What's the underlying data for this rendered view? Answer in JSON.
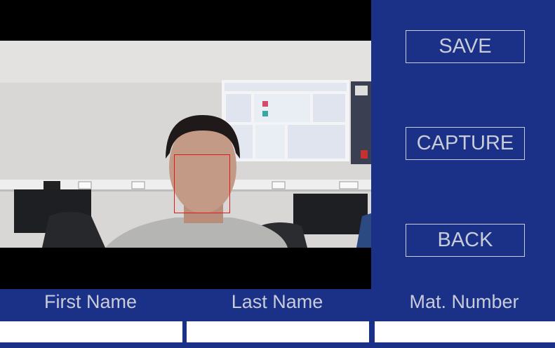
{
  "colors": {
    "background": "#1b3188",
    "button_text": "#c8cbd8",
    "button_border": "#c9cde0",
    "face_box": "#e01818",
    "input_background": "#ffffff"
  },
  "camera": {
    "icon": "webcam-feed",
    "face_detected": true
  },
  "buttons": {
    "save": "SAVE",
    "capture": "CAPTURE",
    "back": "BACK"
  },
  "form": {
    "first_name_label": "First Name",
    "last_name_label": "Last Name",
    "mat_number_label": "Mat. Number",
    "first_name_value": "",
    "last_name_value": "",
    "mat_number_value": ""
  }
}
